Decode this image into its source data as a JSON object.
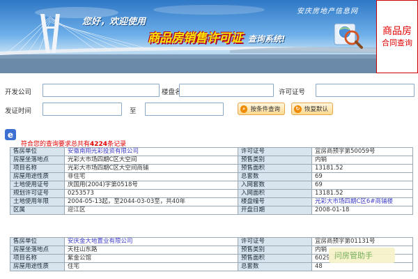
{
  "banner": {
    "brand": "安庆房地产信息网",
    "hello": "您好，欢迎使用",
    "headline": "商品房销售许可证",
    "sub": "查询系统!",
    "side_line1": "商品房",
    "side_line2": "合同查询"
  },
  "form": {
    "developer_label": "开发公司",
    "developer_value": "",
    "building_label": "楼盘名称",
    "building_value": "",
    "permit_label": "许可证号",
    "permit_value": "",
    "issue_time_label": "发证时间",
    "date_from": "",
    "to_label": "至",
    "date_to": "",
    "search_button": "按条件查询",
    "reset_button": "恢复默认"
  },
  "result": {
    "prefix": "符合您的查询要求总共有",
    "count": "4224",
    "suffix": "条记录"
  },
  "records": [
    {
      "rows": [
        [
          "售房单位",
          "安徽南翔光彩投资有限公司",
          "许可证号",
          "宜房商预字第50059号"
        ],
        [
          "房屋坐落地点",
          "光彩大市场四期C区大空间",
          "预售类别",
          "内销"
        ],
        [
          "项目名称",
          "光彩大市场四期C区大空间商铺",
          "预售面积",
          "13181.52"
        ],
        [
          "房屋用途性质",
          "非住宅",
          "总套数",
          "69"
        ],
        [
          "土地使用证号",
          "庆国用(2004)字第0518号",
          "入网套数",
          "69"
        ],
        [
          "规划许可证号",
          "0253573",
          "入网面积",
          "13181.52"
        ],
        [
          "土地使用年限",
          "2004-05-13起，至2044-03-03至，共40年",
          "楼盘幢号",
          "光彩大市场四期C区6#商铺楼"
        ],
        [
          "区属",
          "迎江区",
          "开盘日期",
          "2008-01-18"
        ]
      ]
    },
    {
      "rows": [
        [
          "售房单位",
          "安庆金大地置业有限公司",
          "许可证号",
          "宜房商预字第01131号"
        ],
        [
          "房屋坐落地点",
          "天柱山东路",
          "预售类别",
          "内销"
        ],
        [
          "项目名称",
          "紫金公馆",
          "预售面积",
          "6029.3"
        ],
        [
          "房屋用途性质",
          "住宅",
          "总套数",
          "48"
        ]
      ]
    }
  ],
  "watermark": "问房管助手",
  "colors": {
    "label_cell_bg": "#d8e4ee",
    "link": "#3c3cc8",
    "alert_red": "#e00000",
    "button_orange": "#fbd98f"
  }
}
